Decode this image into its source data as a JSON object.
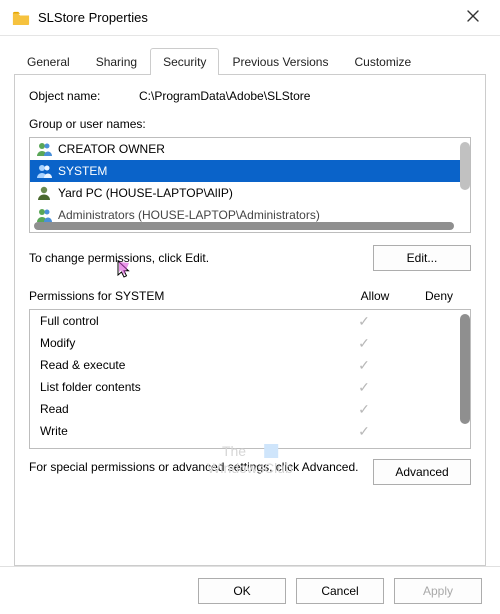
{
  "titlebar": {
    "title": "SLStore Properties"
  },
  "tabs": [
    "General",
    "Sharing",
    "Security",
    "Previous Versions",
    "Customize"
  ],
  "security": {
    "object_label": "Object name:",
    "object_value": "C:\\ProgramData\\Adobe\\SLStore",
    "group_label": "Group or user names:",
    "principals": [
      {
        "name": "CREATOR OWNER",
        "selected": false
      },
      {
        "name": "SYSTEM",
        "selected": true
      },
      {
        "name": "Yard PC (HOUSE-LAPTOP\\AlIP)",
        "selected": false
      },
      {
        "name": "Administrators (HOUSE-LAPTOP\\Administrators)",
        "selected": false
      }
    ],
    "edit_hint": "To change permissions, click Edit.",
    "edit_button": "Edit...",
    "permissions_for": "Permissions for SYSTEM",
    "allow_label": "Allow",
    "deny_label": "Deny",
    "permissions": [
      {
        "name": "Full control",
        "allow": true,
        "deny": false
      },
      {
        "name": "Modify",
        "allow": true,
        "deny": false
      },
      {
        "name": "Read & execute",
        "allow": true,
        "deny": false
      },
      {
        "name": "List folder contents",
        "allow": true,
        "deny": false
      },
      {
        "name": "Read",
        "allow": true,
        "deny": false
      },
      {
        "name": "Write",
        "allow": true,
        "deny": false
      }
    ],
    "advanced_hint": "For special permissions or advanced settings, click Advanced.",
    "advanced_button": "Advanced"
  },
  "footer": {
    "ok": "OK",
    "cancel": "Cancel",
    "apply": "Apply"
  },
  "watermark": {
    "line1": "The",
    "line2": "WindowsClub"
  }
}
